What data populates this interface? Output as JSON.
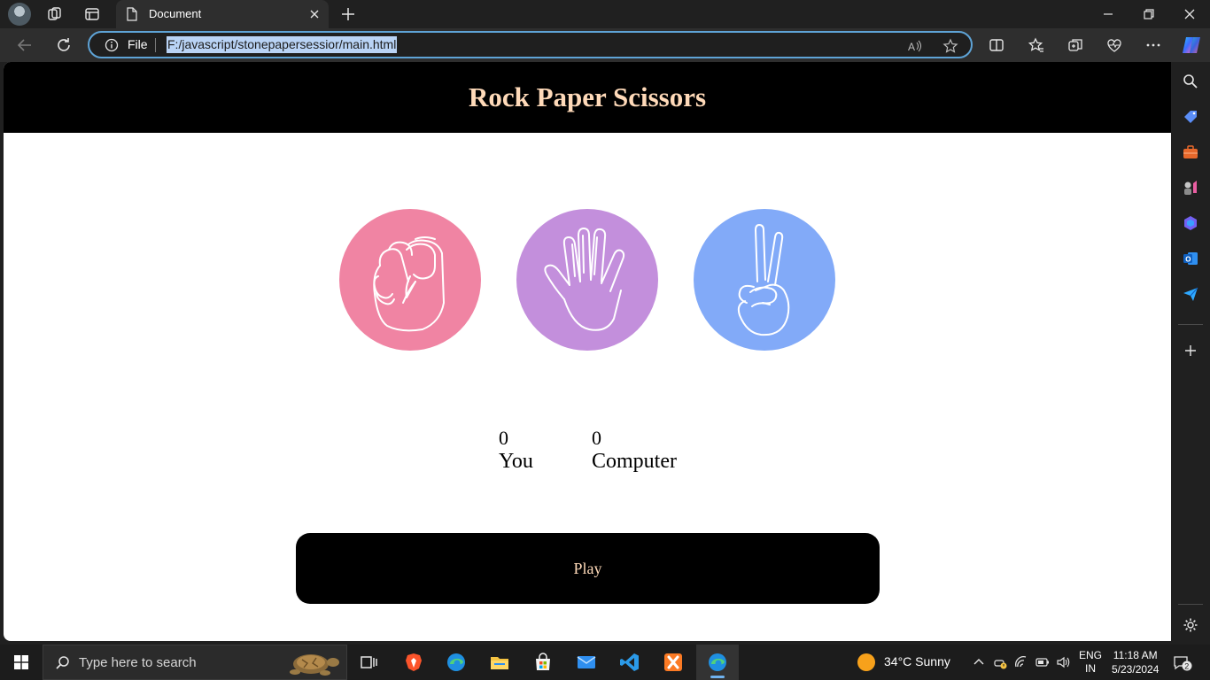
{
  "browser": {
    "tab_title": "Document",
    "scheme_label": "File",
    "url": "F:/javascript/stonepapersessior/main.html"
  },
  "page": {
    "title": "Rock Paper Scissors",
    "choices": [
      {
        "name": "rock",
        "color": "#f084a3",
        "icon": "fist-icon"
      },
      {
        "name": "paper",
        "color": "#c38fdc",
        "icon": "open-hand-icon"
      },
      {
        "name": "scissors",
        "color": "#82aaf8",
        "icon": "peace-sign-icon"
      }
    ],
    "scores": {
      "user_score": "0",
      "user_label": "You",
      "computer_score": "0",
      "computer_label": "Computer"
    },
    "play_label": "Play",
    "accent": "#ffdab9"
  },
  "taskbar": {
    "search_placeholder": "Type here to search",
    "weather": "34°C  Sunny",
    "lang_line1": "ENG",
    "lang_line2": "IN",
    "time": "11:18 AM",
    "date": "5/23/2024",
    "notification_count": "2"
  }
}
